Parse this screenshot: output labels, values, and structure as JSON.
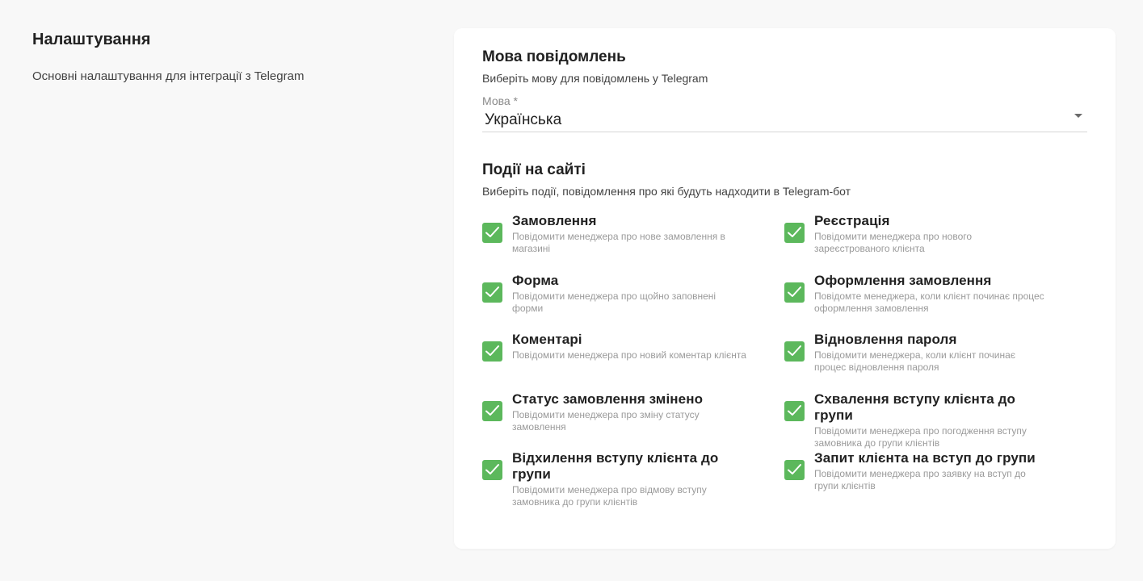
{
  "settings": {
    "title": "Налаштування",
    "description": "Основні налаштування для інтеграції з Telegram"
  },
  "language": {
    "title": "Мова повідомлень",
    "subtitle": "Виберіть мову для повідомлень у Telegram",
    "field_label": "Мова *",
    "value": "Українська"
  },
  "events": {
    "title": "Події на сайті",
    "subtitle": "Виберіть події, повідомлення про які будуть надходити в Telegram-бот",
    "items": [
      {
        "title": "Замовлення",
        "desc": "Повідомити менеджера про нове замовлення в магазині",
        "checked": true
      },
      {
        "title": "Реєстрація",
        "desc": "Повідомити менеджера про нового зареєстрованого клієнта",
        "checked": true
      },
      {
        "title": "Форма",
        "desc": "Повідомити менеджера про щойно заповнені форми",
        "checked": true
      },
      {
        "title": "Оформлення замовлення",
        "desc": "Повідомте менеджера, коли клієнт починає процес оформлення замовлення",
        "checked": true
      },
      {
        "title": "Коментарі",
        "desc": "Повідомити менеджера про новий коментар клієнта",
        "checked": true
      },
      {
        "title": "Відновлення пароля",
        "desc": "Повідомити менеджера, коли клієнт починає процес відновлення пароля",
        "checked": true
      },
      {
        "title": "Статус замовлення змінено",
        "desc": "Повідомити менеджера про зміну статусу замовлення",
        "checked": true
      },
      {
        "title": "Схвалення вступу клієнта до групи",
        "desc": "Повідомити менеджера про погодження вступу замовника до групи клієнтів",
        "checked": true
      },
      {
        "title": "Відхилення вступу клієнта до групи",
        "desc": "Повідомити менеджера про відмову вступу замовника до групи клієнтів",
        "checked": true
      },
      {
        "title": "Запит клієнта на вступ до групи",
        "desc": "Повідомити менеджера про заявку на вступ до групи клієнтів",
        "checked": true
      }
    ]
  },
  "colors": {
    "checkbox": "#5cb85c",
    "background": "#f8f8f8",
    "card": "#ffffff"
  }
}
